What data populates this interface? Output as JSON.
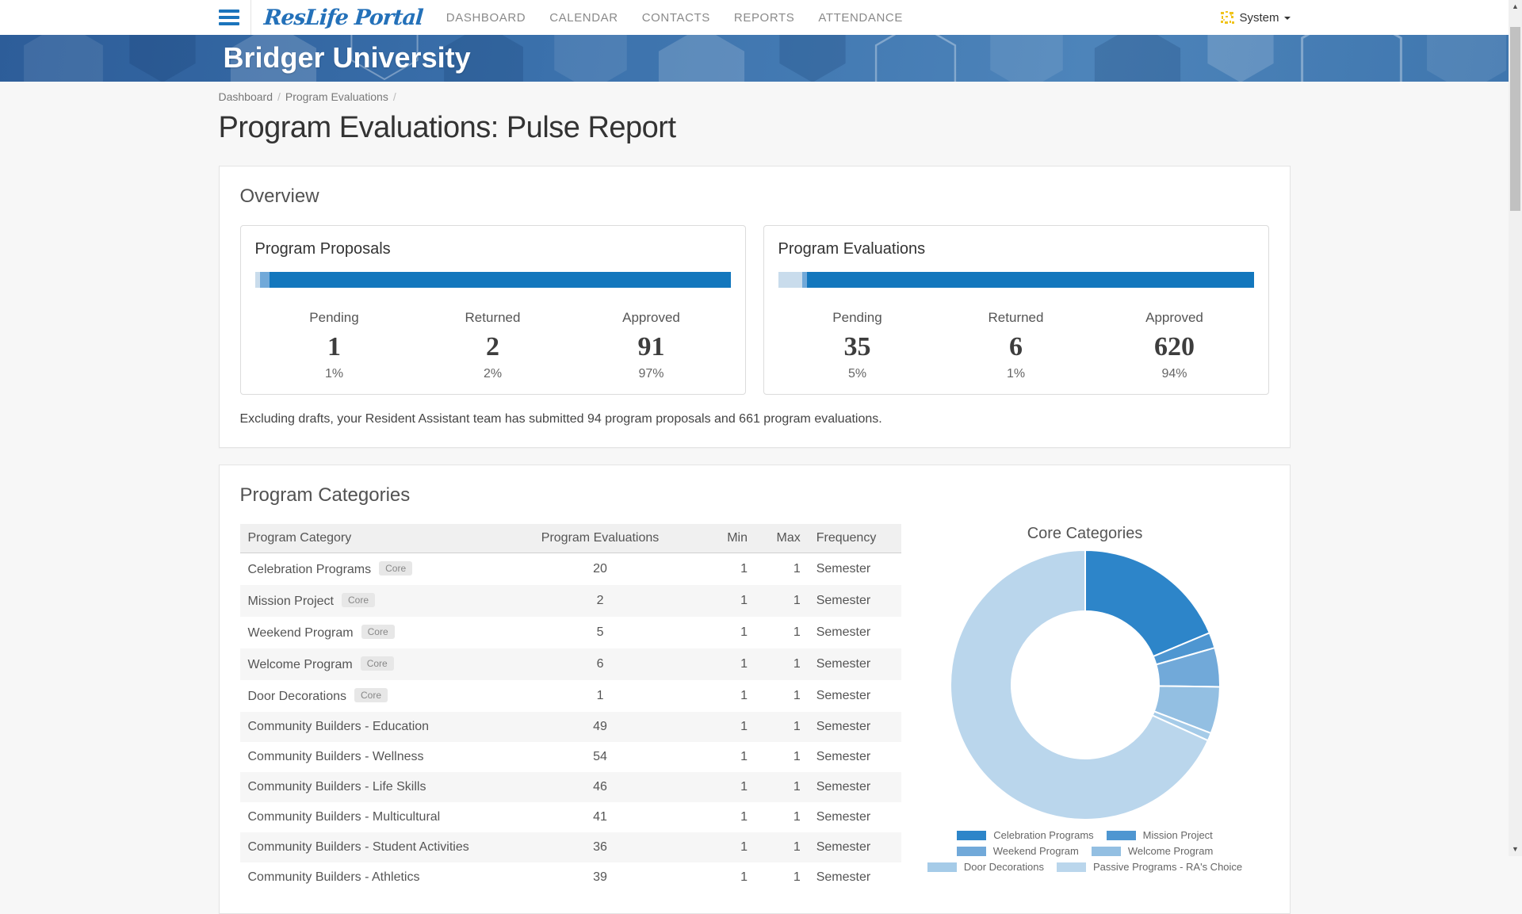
{
  "nav": {
    "brand": "ResLife Portal",
    "items": [
      {
        "label": "DASHBOARD"
      },
      {
        "label": "CALENDAR"
      },
      {
        "label": "CONTACTS"
      },
      {
        "label": "REPORTS"
      },
      {
        "label": "ATTENDANCE"
      }
    ],
    "user": {
      "label": "System"
    }
  },
  "banner": {
    "title": "Bridger University"
  },
  "breadcrumb": {
    "items": [
      "Dashboard",
      "Program Evaluations"
    ]
  },
  "page": {
    "title": "Program Evaluations: Pulse Report"
  },
  "overview": {
    "heading": "Overview",
    "bar_colors": [
      "#c9dcec",
      "#71a9d9",
      "#1377bd"
    ],
    "cards": [
      {
        "title": "Program Proposals",
        "bar": [
          1,
          2,
          97
        ],
        "stats": [
          {
            "label": "Pending",
            "value": "1",
            "percent": "1%"
          },
          {
            "label": "Returned",
            "value": "2",
            "percent": "2%"
          },
          {
            "label": "Approved",
            "value": "91",
            "percent": "97%"
          }
        ]
      },
      {
        "title": "Program Evaluations",
        "bar": [
          5,
          1,
          94
        ],
        "stats": [
          {
            "label": "Pending",
            "value": "35",
            "percent": "5%"
          },
          {
            "label": "Returned",
            "value": "6",
            "percent": "1%"
          },
          {
            "label": "Approved",
            "value": "620",
            "percent": "94%"
          }
        ]
      }
    ],
    "summary": "Excluding drafts, your Resident Assistant team has submitted 94 program proposals and 661 program evaluations."
  },
  "categories": {
    "heading": "Program Categories",
    "core_badge": "Core",
    "table": {
      "columns": [
        "Program Category",
        "Program Evaluations",
        "Min",
        "Max",
        "Frequency"
      ],
      "rows": [
        {
          "name": "Celebration Programs",
          "core": true,
          "evaluations": "20",
          "min": "1",
          "max": "1",
          "frequency": "Semester"
        },
        {
          "name": "Mission Project",
          "core": true,
          "evaluations": "2",
          "min": "1",
          "max": "1",
          "frequency": "Semester"
        },
        {
          "name": "Weekend Program",
          "core": true,
          "evaluations": "5",
          "min": "1",
          "max": "1",
          "frequency": "Semester"
        },
        {
          "name": "Welcome Program",
          "core": true,
          "evaluations": "6",
          "min": "1",
          "max": "1",
          "frequency": "Semester"
        },
        {
          "name": "Door Decorations",
          "core": true,
          "evaluations": "1",
          "min": "1",
          "max": "1",
          "frequency": "Semester"
        },
        {
          "name": "Community Builders - Education",
          "core": false,
          "evaluations": "49",
          "min": "1",
          "max": "1",
          "frequency": "Semester"
        },
        {
          "name": "Community Builders - Wellness",
          "core": false,
          "evaluations": "54",
          "min": "1",
          "max": "1",
          "frequency": "Semester"
        },
        {
          "name": "Community Builders - Life Skills",
          "core": false,
          "evaluations": "46",
          "min": "1",
          "max": "1",
          "frequency": "Semester"
        },
        {
          "name": "Community Builders - Multicultural",
          "core": false,
          "evaluations": "41",
          "min": "1",
          "max": "1",
          "frequency": "Semester"
        },
        {
          "name": "Community Builders - Student Activities",
          "core": false,
          "evaluations": "36",
          "min": "1",
          "max": "1",
          "frequency": "Semester"
        },
        {
          "name": "Community Builders - Athletics",
          "core": false,
          "evaluations": "39",
          "min": "1",
          "max": "1",
          "frequency": "Semester"
        }
      ]
    }
  },
  "chart_data": {
    "type": "pie",
    "donut": true,
    "title": "Core Categories",
    "labels": [
      "Celebration Programs",
      "Mission Project",
      "Weekend Program",
      "Welcome Program",
      "Door Decorations",
      "Passive Programs - RA's Choice"
    ],
    "values": [
      20,
      2,
      5,
      6,
      1,
      73
    ],
    "colors": [
      "#2d85c9",
      "#4e96d1",
      "#71a9d9",
      "#93bfe2",
      "#a5cbe8",
      "#bad6ec"
    ],
    "legend_position": "bottom",
    "start_angle_deg": 0,
    "direction": "clockwise"
  },
  "colors": {
    "brand_blue": "#2471b9",
    "banner_blue": "#3a70ab",
    "nav_link_gray": "#8a8a8a"
  }
}
